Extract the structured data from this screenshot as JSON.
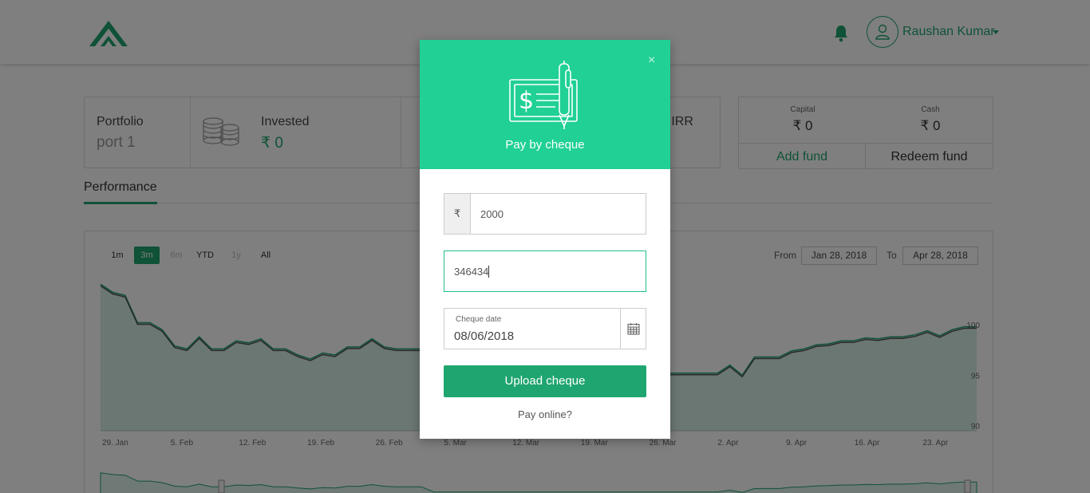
{
  "header": {
    "user_name": "Raushan Kumar",
    "brand_color": "#1fa56f"
  },
  "summary": {
    "portfolio_label": "Portfolio",
    "portfolio_value": "port 1",
    "invested_label": "Invested",
    "invested_value": "₹ 0",
    "irr_label": "e IRR"
  },
  "funds": {
    "capital_label": "Capital",
    "capital_value": "₹ 0",
    "cash_label": "Cash",
    "cash_value": "₹ 0",
    "add_fund_label": "Add fund",
    "redeem_fund_label": "Redeem fund"
  },
  "tabs": {
    "performance_label": "Performance"
  },
  "chart_controls": {
    "ranges": [
      "1m",
      "3m",
      "6m",
      "YTD",
      "1y",
      "All"
    ],
    "selected_range": "3m",
    "from_label": "From",
    "from_value": "Jan 28, 2018",
    "to_label": "To",
    "to_value": "Apr 28, 2018"
  },
  "chart_data": {
    "type": "area",
    "x_tick_labels": [
      "29. Jan",
      "5. Feb",
      "12. Feb",
      "19. Feb",
      "26. Feb",
      "5. Mar",
      "12. Mar",
      "19. Mar",
      "26. Mar",
      "2. Apr",
      "9. Apr",
      "16. Apr",
      "23. Apr"
    ],
    "y_tick_labels": [
      "90",
      "95",
      "100"
    ],
    "ylim": [
      89.5,
      104.5
    ],
    "series_color": "#1fa56f",
    "values": [
      104,
      103.2,
      102.9,
      100.2,
      100.2,
      99.5,
      97.9,
      97.6,
      98.8,
      97.6,
      97.6,
      98.4,
      98.2,
      98.6,
      97.6,
      97.6,
      97,
      96.6,
      97.2,
      97,
      97.8,
      97.8,
      98.6,
      97.8,
      97.6,
      97.6,
      97.6,
      95.2,
      95.2,
      95.2,
      95.2,
      95.2,
      95.2,
      95.2,
      95.2,
      95.2,
      95.2,
      95.2,
      95.2,
      95.2,
      95.2,
      95.2,
      95.2,
      95.2,
      95.2,
      95.2,
      95.2,
      95.2,
      95.2,
      95.2,
      95.2,
      96,
      95,
      96.8,
      96.8,
      96.8,
      97.4,
      97.6,
      98,
      98.1,
      98.4,
      98.4,
      98.7,
      98.6,
      98.8,
      98.8,
      99,
      99.4,
      98.9,
      99.5,
      99.8,
      99.8
    ]
  },
  "modal": {
    "title": "Pay by cheque",
    "close_symbol": "×",
    "currency_symbol": "₹",
    "amount_value": "2000",
    "cheque_number_value": "346434",
    "cheque_date_label": "Cheque date",
    "cheque_date_value": "08/06/2018",
    "upload_button_label": "Upload cheque",
    "pay_online_link": "Pay online?",
    "header_color": "#20d095"
  }
}
